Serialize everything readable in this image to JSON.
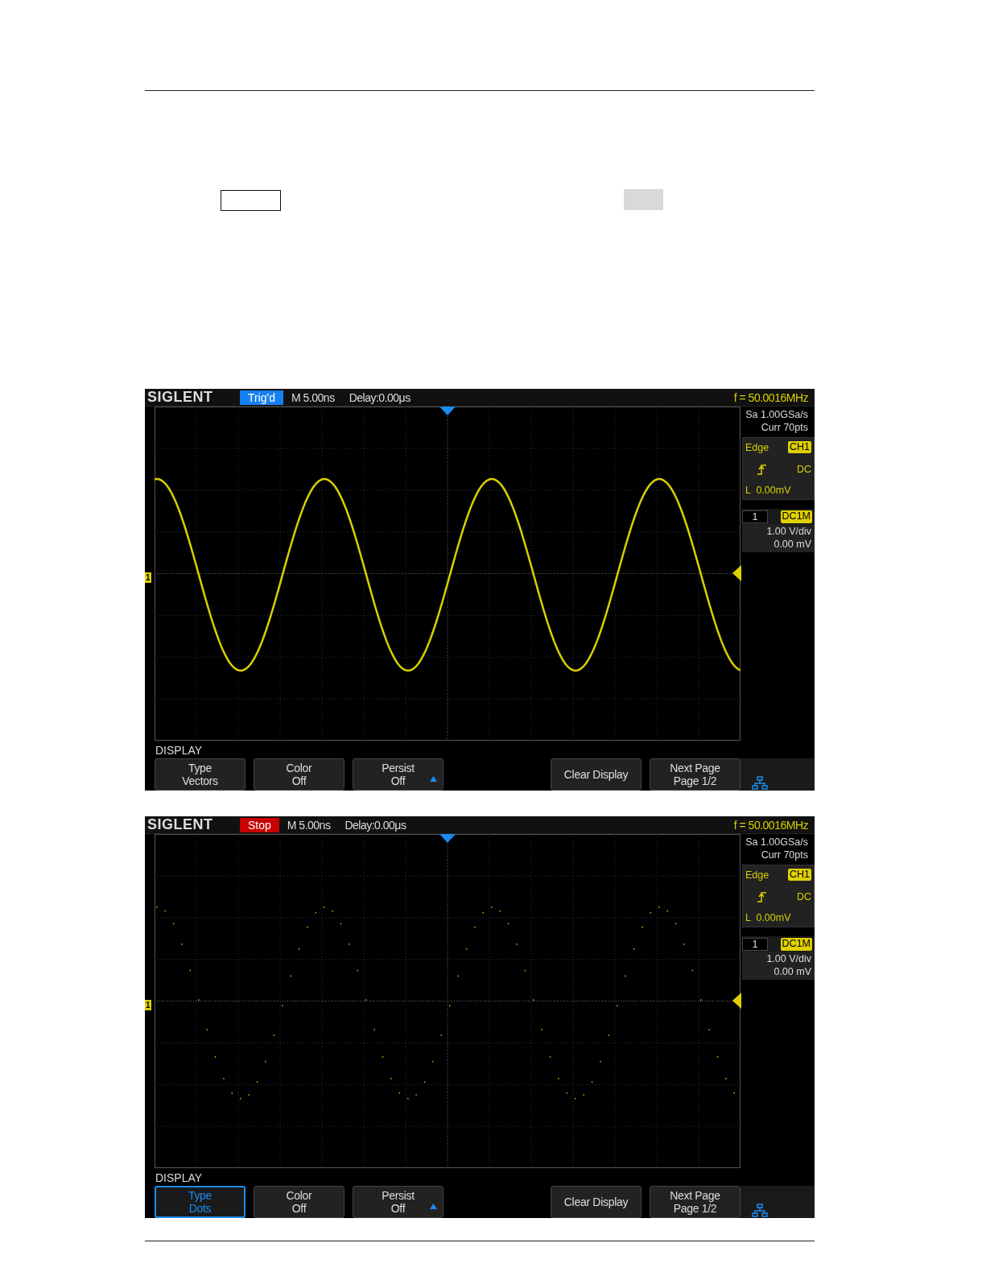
{
  "screens": [
    {
      "logo": "SIGLENT",
      "run_state": {
        "kind": "trigd",
        "label": "Trig'd"
      },
      "timebase": "M 5.00ns",
      "delay": "Delay:0.00μs",
      "frequency": "f = 50.0016MHz",
      "trace": {
        "kind": "line"
      },
      "sample_rate": "Sa 1.00GSa/s",
      "memory": "Curr 70pts",
      "trigger": {
        "type": "Edge",
        "source": "CH1",
        "coupling": "DC",
        "level": "L  0.00mV"
      },
      "channel": {
        "number": "1",
        "coupling": "DC1M",
        "scale": "1.00 V/div",
        "offset": "0.00 mV"
      },
      "ground_marker": "1",
      "menu_title": "DISPLAY",
      "softkeys": [
        {
          "lines": [
            "Type",
            "Vectors"
          ],
          "selected": false,
          "arrow": false
        },
        {
          "lines": [
            "Color",
            "Off"
          ],
          "selected": false,
          "arrow": false
        },
        {
          "lines": [
            "Persist",
            "Off"
          ],
          "selected": false,
          "arrow": true
        },
        {
          "lines": [
            "Clear Display"
          ],
          "selected": false,
          "arrow": false
        },
        {
          "lines": [
            "Next Page",
            "Page 1/2"
          ],
          "selected": false,
          "arrow": false
        }
      ]
    },
    {
      "logo": "SIGLENT",
      "run_state": {
        "kind": "stop",
        "label": "Stop"
      },
      "timebase": "M 5.00ns",
      "delay": "Delay:0.00μs",
      "frequency": "f = 50.0016MHz",
      "trace": {
        "kind": "points"
      },
      "sample_rate": "Sa 1.00GSa/s",
      "memory": "Curr 70pts",
      "trigger": {
        "type": "Edge",
        "source": "CH1",
        "coupling": "DC",
        "level": "L  0.00mV"
      },
      "channel": {
        "number": "1",
        "coupling": "DC1M",
        "scale": "1.00 V/div",
        "offset": "0.00 mV"
      },
      "ground_marker": "1",
      "menu_title": "DISPLAY",
      "softkeys": [
        {
          "lines": [
            "Type",
            "Dots"
          ],
          "selected": true,
          "arrow": false
        },
        {
          "lines": [
            "Color",
            "Off"
          ],
          "selected": false,
          "arrow": false
        },
        {
          "lines": [
            "Persist",
            "Off"
          ],
          "selected": false,
          "arrow": true
        },
        {
          "lines": [
            "Clear Display"
          ],
          "selected": false,
          "arrow": false
        },
        {
          "lines": [
            "Next Page",
            "Page 1/2"
          ],
          "selected": false,
          "arrow": false
        }
      ]
    }
  ]
}
